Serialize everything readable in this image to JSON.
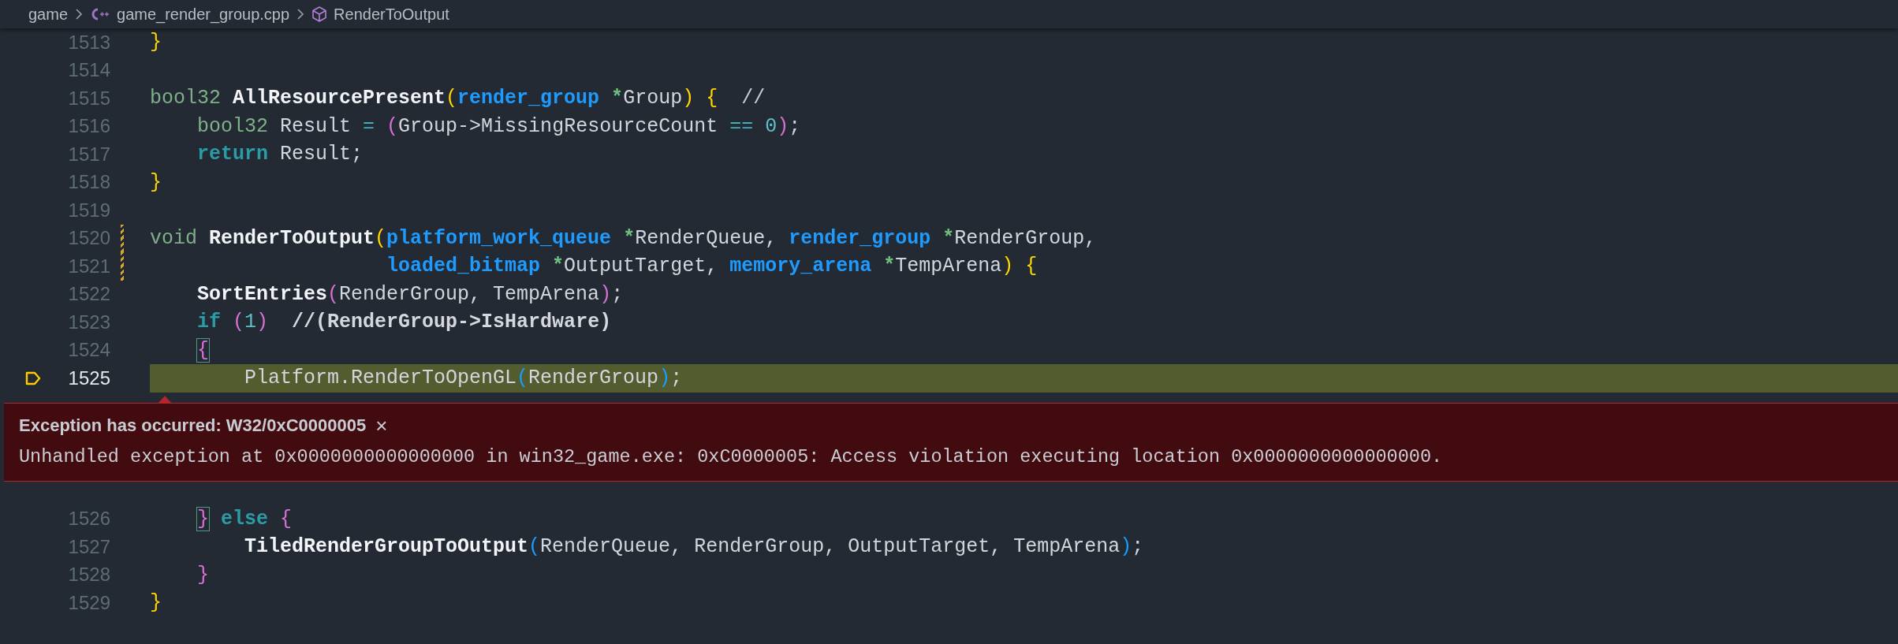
{
  "breadcrumb": [
    {
      "label": "game",
      "kind": "folder"
    },
    {
      "label": "game_render_group.cpp",
      "kind": "cpp-file"
    },
    {
      "label": "RenderToOutput",
      "kind": "method"
    }
  ],
  "lines": [
    {
      "number": "1513",
      "current": false,
      "modified": false,
      "tokens": [
        {
          "text": "}",
          "kind": "b1"
        }
      ]
    },
    {
      "number": "1514",
      "current": false,
      "modified": false
    },
    {
      "number": "1515",
      "current": false,
      "modified": false,
      "tokens": [
        {
          "text": "bool32",
          "kind": "type"
        },
        {
          "text": " AllResourcePresent",
          "kind": "func"
        },
        {
          "text": "(",
          "kind": "b1"
        },
        {
          "text": "render_group",
          "kind": "ptype"
        },
        {
          "text": " *",
          "kind": "star"
        },
        {
          "text": "Group",
          "kind": "plain"
        },
        {
          "text": ")",
          "kind": "b1"
        },
        {
          "text": " {",
          "kind": "b1"
        },
        {
          "text": "  //",
          "kind": "comment"
        }
      ]
    },
    {
      "number": "1516",
      "current": false,
      "modified": false,
      "tokens": [
        {
          "text": "    bool32",
          "kind": "type"
        },
        {
          "text": " Result ",
          "kind": "plain"
        },
        {
          "text": "=",
          "kind": "op"
        },
        {
          "text": " (",
          "kind": "b2"
        },
        {
          "text": "Group->MissingResourceCount ",
          "kind": "plain"
        },
        {
          "text": "==",
          "kind": "op"
        },
        {
          "text": " 0",
          "kind": "num"
        },
        {
          "text": ")",
          "kind": "b2"
        },
        {
          "text": ";",
          "kind": "plain"
        }
      ]
    },
    {
      "number": "1517",
      "current": false,
      "modified": false,
      "tokens": [
        {
          "text": "    return",
          "kind": "keyword"
        },
        {
          "text": " Result;",
          "kind": "plain"
        }
      ]
    },
    {
      "number": "1518",
      "current": false,
      "modified": false,
      "tokens": [
        {
          "text": "}",
          "kind": "b1"
        }
      ]
    },
    {
      "number": "1519",
      "current": false,
      "modified": false
    },
    {
      "number": "1520",
      "current": false,
      "modified": true,
      "tokens": [
        {
          "text": "void",
          "kind": "type"
        },
        {
          "text": " RenderToOutput",
          "kind": "func"
        },
        {
          "text": "(",
          "kind": "b1"
        },
        {
          "text": "platform_work_queue",
          "kind": "ptype"
        },
        {
          "text": " *",
          "kind": "star"
        },
        {
          "text": "RenderQueue, ",
          "kind": "plain"
        },
        {
          "text": "render_group",
          "kind": "ptype"
        },
        {
          "text": " *",
          "kind": "star"
        },
        {
          "text": "RenderGroup,",
          "kind": "plain"
        }
      ]
    },
    {
      "number": "1521",
      "current": false,
      "modified": true,
      "tokens": [
        {
          "text": "                    loaded_bitmap",
          "kind": "ptype"
        },
        {
          "text": " *",
          "kind": "star"
        },
        {
          "text": "OutputTarget, ",
          "kind": "plain"
        },
        {
          "text": "memory_arena",
          "kind": "ptype"
        },
        {
          "text": " *",
          "kind": "star"
        },
        {
          "text": "TempArena",
          "kind": "plain"
        },
        {
          "text": ")",
          "kind": "b1"
        },
        {
          "text": " {",
          "kind": "b1"
        }
      ]
    },
    {
      "number": "1522",
      "current": false,
      "modified": false,
      "tokens": [
        {
          "text": "    SortEntries",
          "kind": "func"
        },
        {
          "text": "(",
          "kind": "b2"
        },
        {
          "text": "RenderGroup, TempArena",
          "kind": "plain"
        },
        {
          "text": ")",
          "kind": "b2"
        },
        {
          "text": ";",
          "kind": "plain"
        }
      ]
    },
    {
      "number": "1523",
      "current": false,
      "modified": false,
      "tokens": [
        {
          "text": "    if",
          "kind": "keyword"
        },
        {
          "text": " (",
          "kind": "b2"
        },
        {
          "text": "1",
          "kind": "num"
        },
        {
          "text": ")",
          "kind": "b2"
        },
        {
          "text": "  //(RenderGroup->IsHardware)",
          "kind": "comment-bold"
        }
      ]
    },
    {
      "number": "1524",
      "current": false,
      "modified": false,
      "tokens": [
        {
          "text": "    {",
          "kind": "b2-match"
        }
      ]
    },
    {
      "number": "1525",
      "current": true,
      "modified": false,
      "tokens": [
        {
          "text": "        Platform.RenderToOpenGL",
          "kind": "plain"
        },
        {
          "text": "(",
          "kind": "b3"
        },
        {
          "text": "RenderGroup",
          "kind": "plain"
        },
        {
          "text": ")",
          "kind": "b3"
        },
        {
          "text": ";",
          "kind": "plain"
        }
      ]
    },
    {
      "number": "1526",
      "current": false,
      "modified": false,
      "tokens": [
        {
          "text": "    }",
          "kind": "b2-match"
        },
        {
          "text": " else",
          "kind": "keyword"
        },
        {
          "text": " {",
          "kind": "b2"
        }
      ]
    },
    {
      "number": "1527",
      "current": false,
      "modified": false,
      "tokens": [
        {
          "text": "        TiledRenderGroupToOutput",
          "kind": "func"
        },
        {
          "text": "(",
          "kind": "b3"
        },
        {
          "text": "RenderQueue, RenderGroup, OutputTarget, TempArena",
          "kind": "plain"
        },
        {
          "text": ")",
          "kind": "b3"
        },
        {
          "text": ";",
          "kind": "plain"
        }
      ]
    },
    {
      "number": "1528",
      "current": false,
      "modified": false,
      "tokens": [
        {
          "text": "    }",
          "kind": "b2"
        }
      ]
    },
    {
      "number": "1529",
      "current": false,
      "modified": false,
      "tokens": [
        {
          "text": "}",
          "kind": "b1"
        }
      ]
    }
  ],
  "exception": {
    "title": "Exception has occurred: W32/0xC0000005",
    "close": "×",
    "message": "Unhandled exception at 0x0000000000000000 in win32_game.exe: 0xC0000005: Access violation executing location 0x0000000000000000."
  }
}
